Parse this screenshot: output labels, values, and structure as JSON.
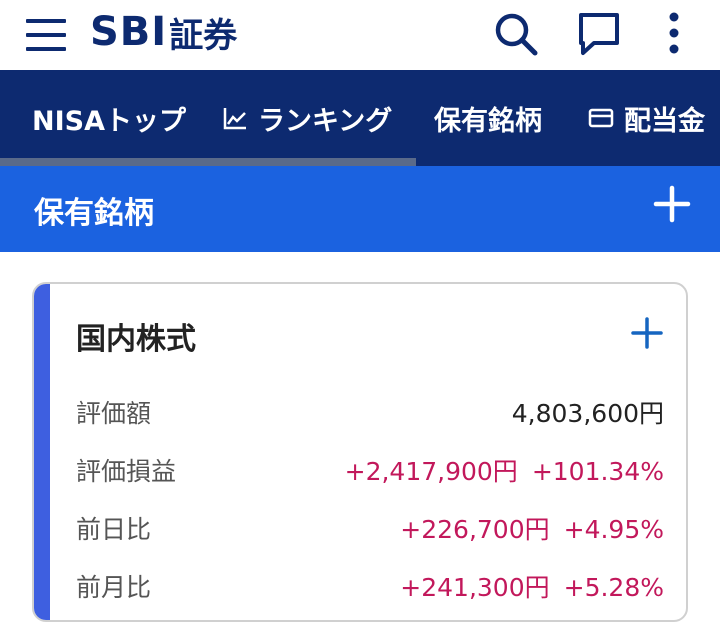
{
  "header": {
    "logo_latin": "SBI",
    "logo_jp": "証券",
    "icons": [
      "menu-icon",
      "search-icon",
      "chat-icon",
      "more-vertical-icon"
    ]
  },
  "tabs": [
    {
      "label": "NISAトップ",
      "icon": null
    },
    {
      "label": "ランキング",
      "icon": "ranking-chart-icon"
    },
    {
      "label": "保有銘柄",
      "icon": null,
      "selected": true
    },
    {
      "label": "配当金",
      "icon": "card-icon"
    }
  ],
  "section": {
    "title": "保有銘柄",
    "add_icon": "plus-icon"
  },
  "card": {
    "title": "国内株式",
    "add_icon": "plus-icon",
    "rows": [
      {
        "label": "評価額",
        "amount": "4,803,600円",
        "percent": ""
      },
      {
        "label": "評価損益",
        "amount": "+2,417,900円",
        "percent": "+101.34%"
      },
      {
        "label": "前日比",
        "amount": "+226,700円",
        "percent": "+4.95%"
      },
      {
        "label": "前月比",
        "amount": "+241,300円",
        "percent": "+5.28%"
      }
    ]
  },
  "colors": {
    "brand_navy": "#0d2a70",
    "section_blue": "#1b62e0",
    "card_accent": "#3e5fe0",
    "positive": "#c2185b"
  }
}
